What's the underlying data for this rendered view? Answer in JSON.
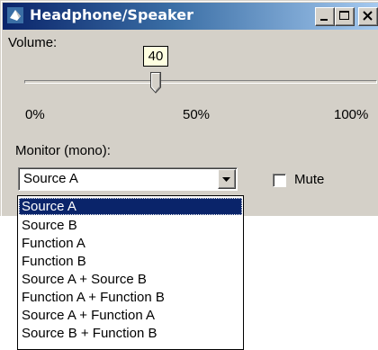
{
  "window": {
    "title": "Headphone/Speaker",
    "colors": {
      "titlebar_start": "#0a246a",
      "titlebar_end": "#a6caf0",
      "face": "#d4d0c8",
      "selection": "#0a246a"
    },
    "caption_buttons": [
      "minimize-icon",
      "maximize-icon",
      "close-icon"
    ]
  },
  "volume": {
    "label": "Volume:",
    "value": 40,
    "tooltip": "40",
    "tick_labels": {
      "min": "0%",
      "mid": "50%",
      "max": "100%"
    }
  },
  "monitor": {
    "label": "Monitor (mono):",
    "selected": "Source A",
    "options": [
      "Source A",
      "Source B",
      "Function A",
      "Function B",
      "Source A + Source B",
      "Function A + Function B",
      "Source A + Function A",
      "Source B + Function B"
    ],
    "highlighted_index": 0
  },
  "mute": {
    "label": "Mute",
    "checked": false
  }
}
